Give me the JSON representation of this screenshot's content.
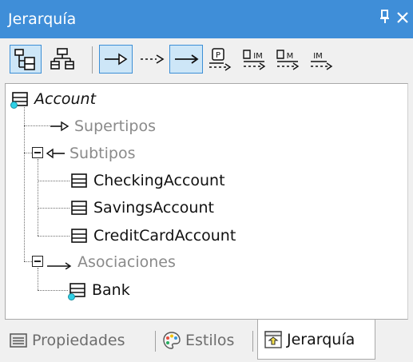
{
  "window": {
    "title": "Jerarquía",
    "pin_glyph": "❙",
    "close_glyph": "✕"
  },
  "toolbar": {
    "buttons": [
      {
        "name": "show-tree-icon",
        "active": true
      },
      {
        "name": "show-graph-icon",
        "active": false
      },
      {
        "name": "generalization-icon",
        "active": true
      },
      {
        "name": "realization-icon",
        "active": false
      },
      {
        "name": "association-icon",
        "active": true
      },
      {
        "name": "package-dependency-icon",
        "active": false,
        "label": "P"
      },
      {
        "name": "import-dependency-icon",
        "active": false,
        "label": "IM"
      },
      {
        "name": "merge-dependency-icon",
        "active": false,
        "label": "M"
      },
      {
        "name": "other-dependency-icon",
        "active": false,
        "label": "IM"
      }
    ]
  },
  "tree": {
    "root": "Account",
    "supertypes": "Supertipos",
    "subtypes": "Subtipos",
    "subtype_items": [
      "CheckingAccount",
      "SavingsAccount",
      "CreditCardAccount"
    ],
    "associations": "Asociaciones",
    "association_items": [
      "Bank"
    ]
  },
  "tabs": [
    {
      "label": "Propiedades",
      "active": false
    },
    {
      "label": "Estilos",
      "active": false
    },
    {
      "label": "Jerarquía",
      "active": true
    }
  ],
  "colors": {
    "titlebar": "#3f8ed8",
    "active_button_bg": "#cde6f7",
    "active_button_border": "#3c8fd6",
    "gray_label": "#8a8a8a"
  }
}
